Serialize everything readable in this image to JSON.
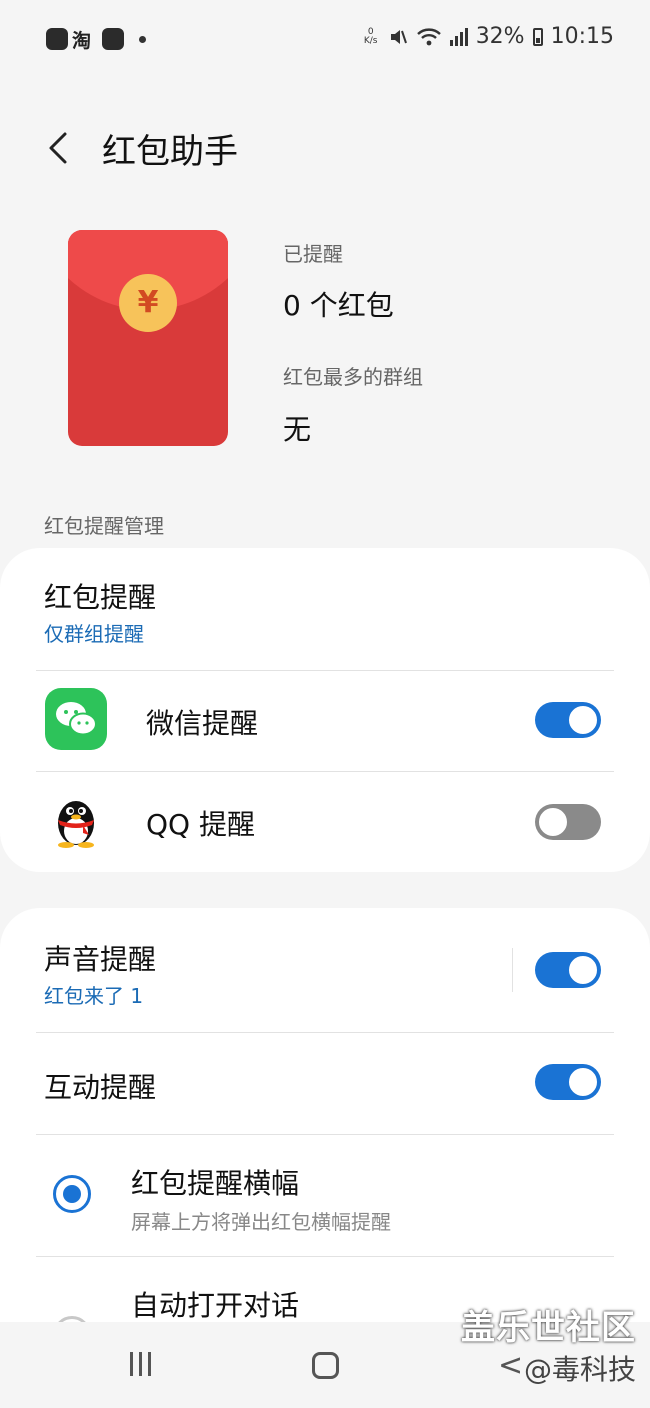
{
  "status_bar": {
    "taobao_label": "淘",
    "speed_value": "0",
    "speed_unit": "K/s",
    "battery": "32%",
    "time": "10:15"
  },
  "header": {
    "title": "红包助手"
  },
  "summary": {
    "reminded_label": "已提醒",
    "reminded_value": "0 个红包",
    "top_group_label": "红包最多的群组",
    "top_group_value": "无",
    "coin_symbol": "¥"
  },
  "section": {
    "title": "红包提醒管理"
  },
  "card1": {
    "reminder_title": "红包提醒",
    "reminder_sub": "仅群组提醒",
    "wechat_label": "微信提醒",
    "wechat_on": true,
    "qq_label": "QQ 提醒",
    "qq_on": false
  },
  "card2": {
    "sound_title": "声音提醒",
    "sound_sub": "红包来了 1",
    "sound_on": true,
    "interactive_title": "互动提醒",
    "interactive_on": true,
    "banner_title": "红包提醒横幅",
    "banner_sub": "屏幕上方将弹出红包横幅提醒",
    "banner_selected": true,
    "auto_open_title": "自动打开对话"
  },
  "watermark": {
    "line1": "盖乐世社区",
    "line2": "@毒科技"
  },
  "colors": {
    "accent": "#1a73d4",
    "envelope_red": "#d93a3a",
    "coin_gold": "#f7c35a",
    "wechat_green": "#2dc35a"
  }
}
